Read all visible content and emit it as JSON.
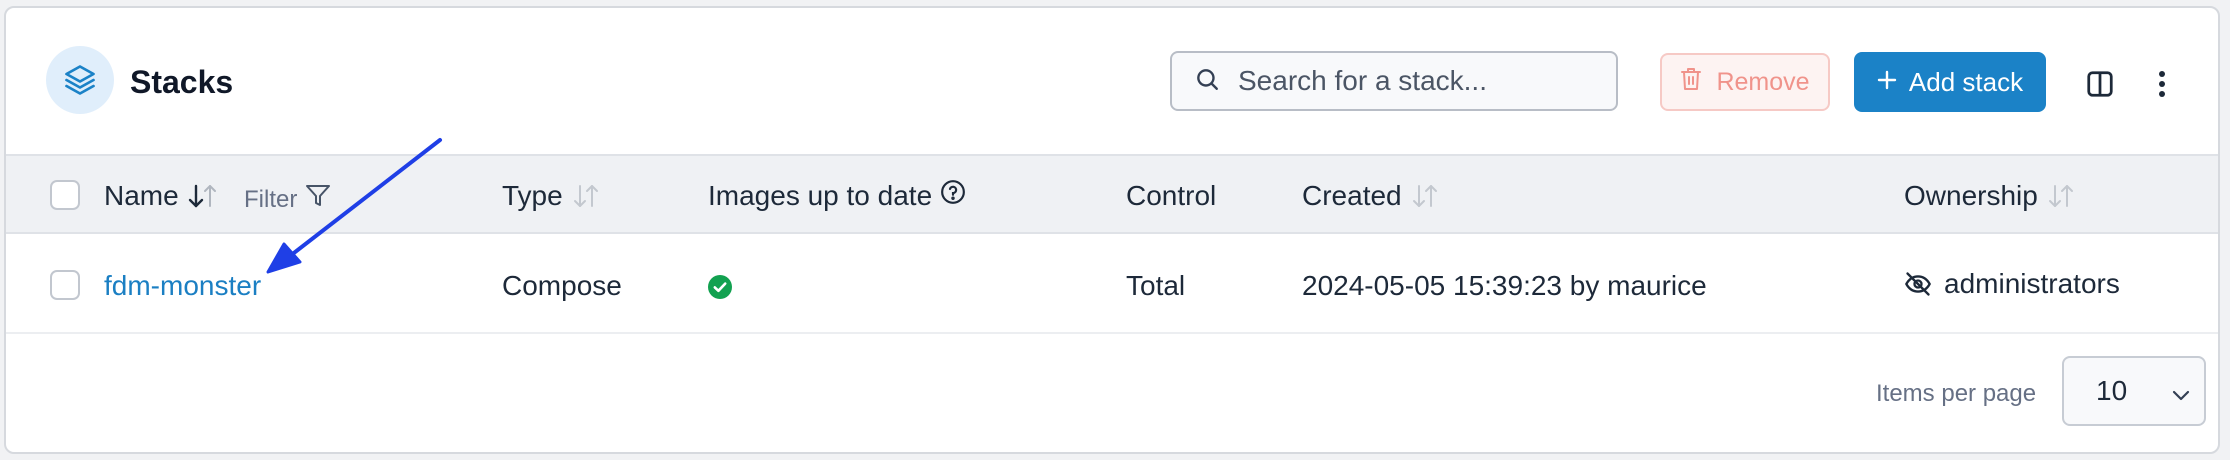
{
  "header": {
    "title": "Stacks",
    "search_placeholder": "Search for a stack...",
    "remove_label": "Remove",
    "add_label": "Add stack"
  },
  "table": {
    "columns": {
      "name": "Name",
      "filter": "Filter",
      "type": "Type",
      "images": "Images up to date",
      "control": "Control",
      "created": "Created",
      "ownership": "Ownership"
    },
    "rows": [
      {
        "name": "fdm-monster",
        "type": "Compose",
        "images_up_to_date": true,
        "control": "Total",
        "created": "2024-05-05 15:39:23 by maurice",
        "ownership": "administrators"
      }
    ]
  },
  "footer": {
    "items_per_page_label": "Items per page",
    "items_per_page_value": "10"
  },
  "icons": {
    "title": "layers-icon",
    "search": "search-icon",
    "remove": "trash-icon",
    "add": "plus-icon",
    "columns": "columns-icon",
    "more": "kebab-icon",
    "sort": "sort-arrows-icon",
    "filter": "filter-icon",
    "help": "help-circle-icon",
    "status": "check-circle-icon",
    "ownership": "eye-off-icon"
  },
  "colors": {
    "accent": "#1b82c7",
    "link": "#1b7fc3",
    "danger_light": "#f0938b",
    "success": "#12a150",
    "annotation_arrow": "#1f3fe6"
  }
}
